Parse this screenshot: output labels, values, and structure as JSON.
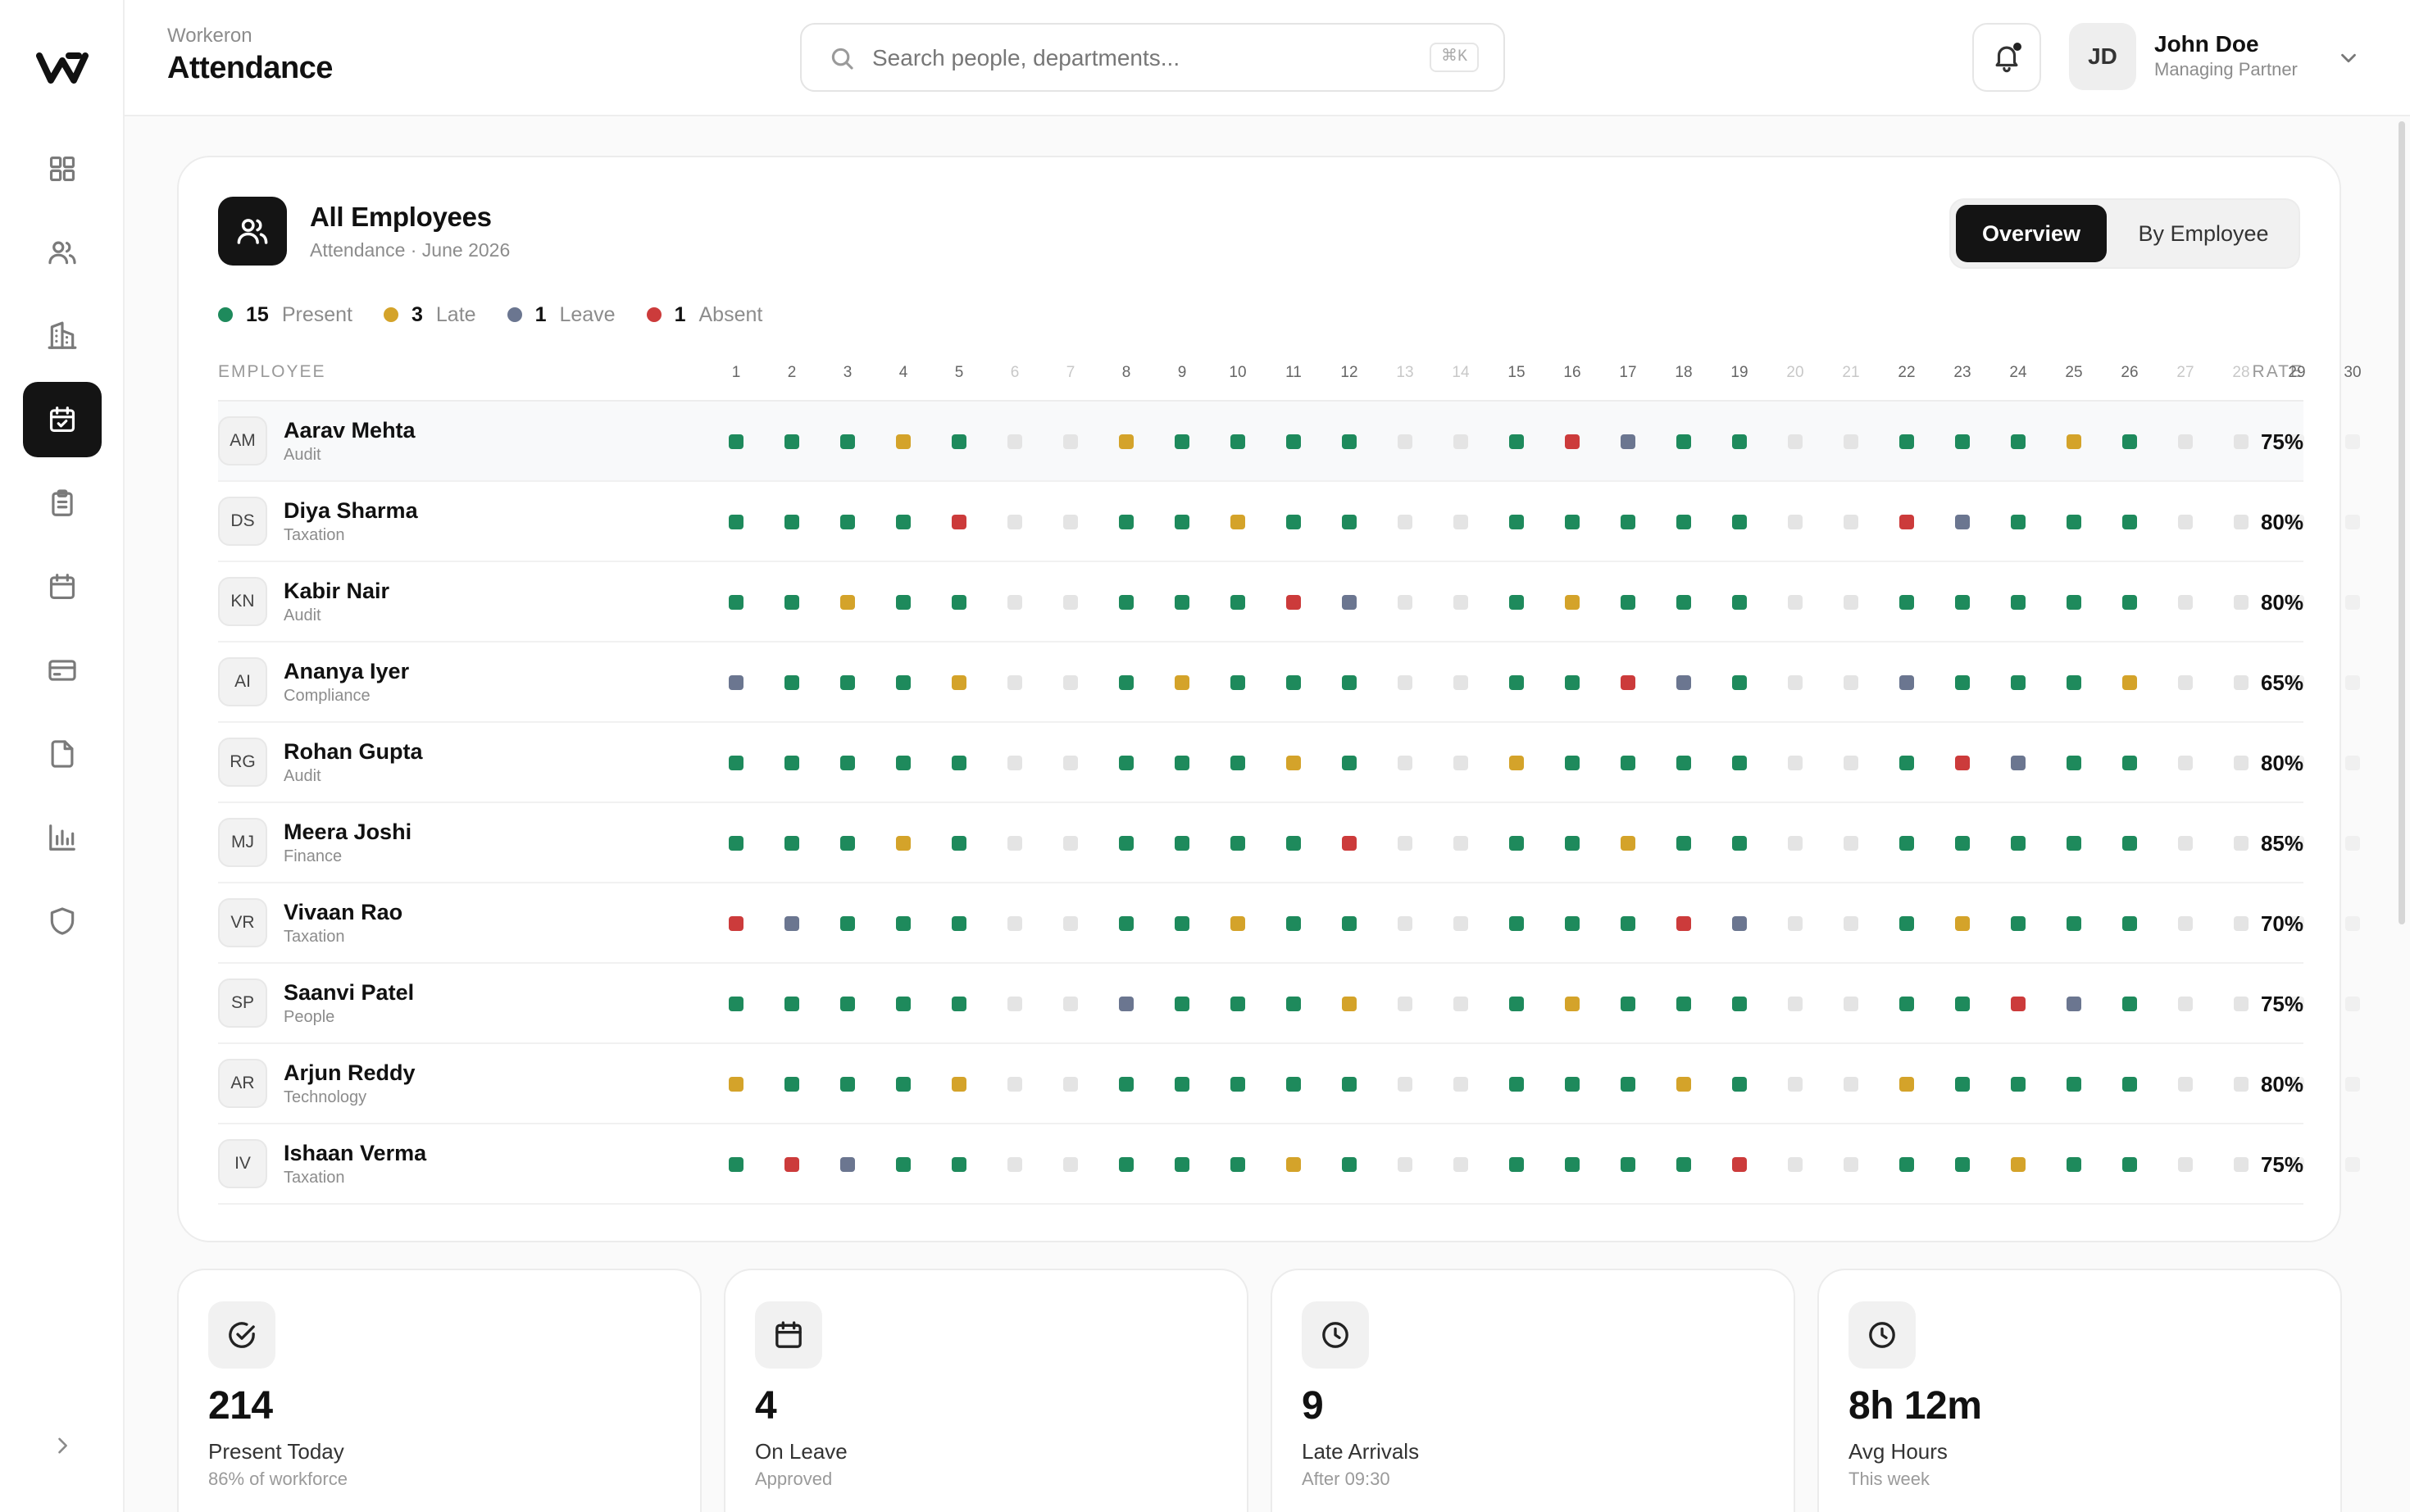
{
  "header": {
    "breadcrumb": "Workeron",
    "title": "Attendance",
    "search_placeholder": "Search people, departments...",
    "search_shortcut": "⌘K",
    "user": {
      "initials": "JD",
      "name": "John Doe",
      "role": "Managing Partner"
    }
  },
  "sidebar": {
    "items": [
      {
        "icon": "dashboard-icon",
        "active": false
      },
      {
        "icon": "people-icon",
        "active": false
      },
      {
        "icon": "building-icon",
        "active": false
      },
      {
        "icon": "calendar-check-icon",
        "active": true
      },
      {
        "icon": "clipboard-icon",
        "active": false
      },
      {
        "icon": "calendar-icon",
        "active": false
      },
      {
        "icon": "credit-card-icon",
        "active": false
      },
      {
        "icon": "document-icon",
        "active": false
      },
      {
        "icon": "bar-chart-icon",
        "active": false
      },
      {
        "icon": "shield-icon",
        "active": false
      }
    ]
  },
  "card": {
    "title": "All Employees",
    "subtitle": "Attendance · June 2026",
    "tabs": [
      "Overview",
      "By Employee"
    ],
    "active_tab": "Overview",
    "summary": [
      {
        "key": "P",
        "count": "15",
        "label": "Present"
      },
      {
        "key": "L",
        "count": "3",
        "label": "Late"
      },
      {
        "key": "V",
        "count": "1",
        "label": "Leave"
      },
      {
        "key": "A",
        "count": "1",
        "label": "Absent"
      }
    ],
    "col_employee": "EMPLOYEE",
    "col_rate": "RATE",
    "days": [
      "1",
      "2",
      "3",
      "4",
      "5",
      "6",
      "7",
      "8",
      "9",
      "10",
      "11",
      "12",
      "13",
      "14",
      "15",
      "16",
      "17",
      "18",
      "19",
      "20",
      "21",
      "22",
      "23",
      "24",
      "25",
      "26",
      "27",
      "28",
      "29",
      "30"
    ],
    "weekend_days": [
      6,
      7,
      13,
      14,
      20,
      21,
      27,
      28
    ]
  },
  "status_colors": {
    "P": "#1e8a5c",
    "L": "#d4a32a",
    "V": "#6b7690",
    "A": "#cc3b3b",
    "W": "#e4e4e4",
    "F": "#f0f0f0"
  },
  "employees": [
    {
      "initials": "AM",
      "name": "Aarav Mehta",
      "dept": "Audit",
      "rate": "75%",
      "days": "PPPLPWWLPPPPWWPAVPPWWPPPLPWWFF"
    },
    {
      "initials": "DS",
      "name": "Diya Sharma",
      "dept": "Taxation",
      "rate": "80%",
      "days": "PPPPAWWPPLPPWWPPPPPWWAVPPPWWFF"
    },
    {
      "initials": "KN",
      "name": "Kabir Nair",
      "dept": "Audit",
      "rate": "80%",
      "days": "PPLPPWWPPPAVWWPLPPPWWPPPPPWWFF"
    },
    {
      "initials": "AI",
      "name": "Ananya Iyer",
      "dept": "Compliance",
      "rate": "65%",
      "days": "VPPPLWWPLPPPWWPPAVPWWVPPPLWWFF"
    },
    {
      "initials": "RG",
      "name": "Rohan Gupta",
      "dept": "Audit",
      "rate": "80%",
      "days": "PPPPPWWPPPLPWWLPPPPWWPAVPPWWFF"
    },
    {
      "initials": "MJ",
      "name": "Meera Joshi",
      "dept": "Finance",
      "rate": "85%",
      "days": "PPPLPWWPPPPAWWPPLPPWWPPPPPWWFF"
    },
    {
      "initials": "VR",
      "name": "Vivaan Rao",
      "dept": "Taxation",
      "rate": "70%",
      "days": "AVPPPWWPPLPPWWPPPAVWWPLPPPWWFF"
    },
    {
      "initials": "SP",
      "name": "Saanvi Patel",
      "dept": "People",
      "rate": "75%",
      "days": "PPPPPWWVPPPLWWPLPPPWWPPAVPWWFF"
    },
    {
      "initials": "AR",
      "name": "Arjun Reddy",
      "dept": "Technology",
      "rate": "80%",
      "days": "LPPPLWWPPPPPWWPPPLPWWLPPPPWWFF"
    },
    {
      "initials": "IV",
      "name": "Ishaan Verma",
      "dept": "Taxation",
      "rate": "75%",
      "days": "PAVPPWWPPPLPWWPPPPAWWPPLPPWWFF"
    }
  ],
  "stats": [
    {
      "icon": "check-circle-icon",
      "value": "214",
      "label": "Present Today",
      "sub": "86% of workforce"
    },
    {
      "icon": "calendar-icon",
      "value": "4",
      "label": "On Leave",
      "sub": "Approved"
    },
    {
      "icon": "clock-icon",
      "value": "9",
      "label": "Late Arrivals",
      "sub": "After 09:30"
    },
    {
      "icon": "clock-icon",
      "value": "8h 12m",
      "label": "Avg Hours",
      "sub": "This week"
    }
  ]
}
